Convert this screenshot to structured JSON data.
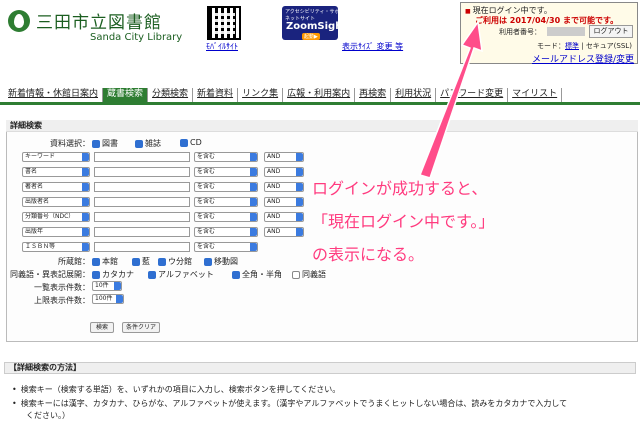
{
  "header": {
    "library_name_jp": "三田市立図書館",
    "library_name_en": "Sanda City Library",
    "mobile_site_link": "ﾓﾊﾞｲﾙｻｲﾄ",
    "zoom_top": "アクセシビリティ・サポーター",
    "zoom_mid": "ネットサイト",
    "zoom_title": "ZoomSight",
    "zoom_button": "起動▶",
    "text_size_link": "表示ｻｲｽﾞ 変更 等"
  },
  "login_box": {
    "status": "現在ログイン中です。",
    "expire_note": "ご利用は 2017/04/30 まで可能です。",
    "user_label": "利用者番号：",
    "logout_label": "ログアウト",
    "mode_label": "モード：",
    "mode_standard": "標準",
    "mode_sep": " | ",
    "mode_secure": "セキュア(SSL)"
  },
  "mail_link": "メールアドレス登録/変更",
  "nav": {
    "items": [
      {
        "label": "新着情報・休館日案内",
        "active": false
      },
      {
        "label": "蔵書検索",
        "active": true
      },
      {
        "label": "分類検索",
        "active": false
      },
      {
        "label": "新着資料",
        "active": false
      },
      {
        "label": "リンク集",
        "active": false
      },
      {
        "label": "広報・利用案内",
        "active": false
      },
      {
        "label": "再検索",
        "active": false
      },
      {
        "label": "利用状況",
        "active": false
      },
      {
        "label": "パスワード変更",
        "active": false
      },
      {
        "label": "マイリスト",
        "active": false
      }
    ]
  },
  "search": {
    "title": "詳細検索",
    "material_label": "資料選択：",
    "material_options": [
      "図書",
      "雑誌",
      "CD"
    ],
    "fields": [
      {
        "name": "キーワード",
        "match": "を含む",
        "op": "AND"
      },
      {
        "name": "書名",
        "match": "を含む",
        "op": "AND"
      },
      {
        "name": "著者名",
        "match": "を含む",
        "op": "AND"
      },
      {
        "name": "出版者名",
        "match": "を含む",
        "op": "AND"
      },
      {
        "name": "分類番号（NDC）",
        "match": "を含む",
        "op": "AND"
      },
      {
        "name": "出版年",
        "match": "を含む",
        "op": "AND"
      },
      {
        "name": "ＩＳＢＮ等",
        "match": "を含む",
        "op": ""
      }
    ],
    "branch_label": "所蔵館：",
    "branch_options": [
      "本館",
      "藍",
      "ウ分館",
      "移動図"
    ],
    "synonym_label": "同義語・異表記展開：",
    "synonym_options": [
      {
        "label": "カタカナ",
        "checked": true
      },
      {
        "label": "アルファベット",
        "checked": true
      },
      {
        "label": "全角・半角",
        "checked": true
      },
      {
        "label": "同義語",
        "checked": false
      }
    ],
    "display_count_label": "一覧表示件数：",
    "display_count_value": "10件",
    "limit_label": "上限表示件数：",
    "limit_value": "100件",
    "search_button": "検索",
    "clear_button": "条件クリア"
  },
  "usage": {
    "title": "【詳細検索の方法】",
    "lines": [
      "検索キー（検索する単語）を、いずれかの項目に入力し、検索ボタンを押してください。",
      "検索キーには漢字、カタカナ、ひらがな、アルファベットが使えます。（漢字やアルファベットでうまくヒットしない場合は、読みをカタカナで入力して",
      "ください。）"
    ]
  },
  "annotation": {
    "line1": "ログインが成功すると、",
    "line2": "「現在ログイン中です。」",
    "line3": "の表示になる。",
    "color": "#ff3b7f"
  }
}
